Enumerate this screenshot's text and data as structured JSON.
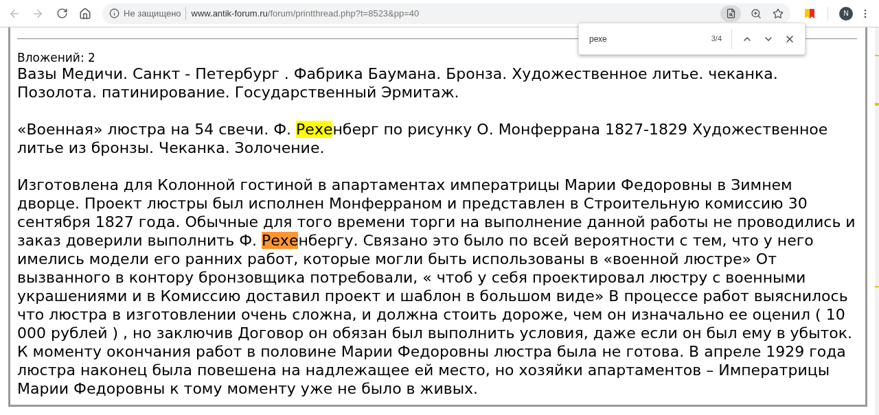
{
  "toolbar": {
    "security": "Не защищено",
    "url_host": "www.antik-forum.ru",
    "url_path": "/forum/printthread.php?t=8523&pp=40",
    "avatar": "N"
  },
  "find_bar": {
    "query": "рехе",
    "count": "3/4"
  },
  "post": {
    "attachments": "Вложений: 2",
    "paragraphs": [
      [
        {
          "text": "Вазы Медичи. Санкт - Петербург . Фабрика Баумана. Бронза. Художественное литье. чеканка. Позолота. патинирование. Государственный Эрмитаж.",
          "match": false,
          "current": false
        }
      ],
      [
        {
          "text": "«Военная» люстра на 54 свечи. Ф. ",
          "match": false,
          "current": false
        },
        {
          "text": "Рехе",
          "match": true,
          "current": false
        },
        {
          "text": "нберг по рисунку О. Монферрана 1827-1829 Художественное литье из бронзы. Чеканка. Золочение.",
          "match": false,
          "current": false
        }
      ],
      [
        {
          "text": "Изготовлена для Колонной гостиной в апартаментах императрицы Марии Федоровны в Зимнем дворце. Проект люстры был исполнен Монферраном и представлен в Строительную комиссию 30 сентября 1827 года. Обычные для того времени торги на выполнение данной работы не проводились и заказ доверили выполнить Ф. ",
          "match": false,
          "current": false
        },
        {
          "text": "Рехе",
          "match": true,
          "current": true
        },
        {
          "text": "нбергу. Связано это было по всей вероятности с тем, что у него имелись модели его ранних работ, которые могли быть использованы в «военной люстре» От вызванного в контору бронзовщика потребовали, « чтоб у себя проектировал люстру с военными украшениями и в Комиссию доставил проект и шаблон в большом виде» В процессе работ выяснилось что люстра в изготовлении очень сложна, и должна стоить дороже, чем он изначально ее оценил ( 10 000 рублей ) , но заключив Договор он обязан был выполнить условия, даже если он был ему в убыток. К моменту окончания работ в половине Марии Федоровны люстра была не готова. В апреле 1929 года люстра наконец была повешена на надлежащее ей место, но хозяйки апартаментов – Императрицы Марии Федоровны к тому моменту уже не было в живых.",
          "match": false,
          "current": false
        }
      ]
    ]
  }
}
